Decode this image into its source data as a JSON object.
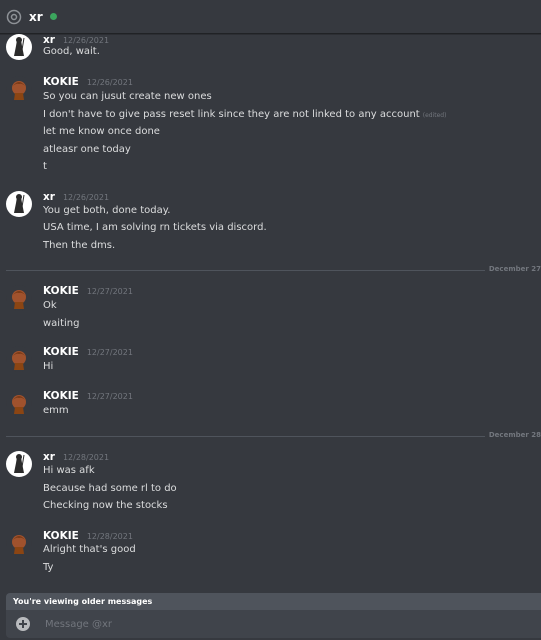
{
  "header": {
    "at_symbol": "@",
    "title": "xr",
    "status_color": "#3ba55d"
  },
  "messages": [
    {
      "author": "xr",
      "timestamp": "12/26/2021",
      "lines": [
        "Good, wait."
      ]
    },
    {
      "author": "KOKIE",
      "timestamp": "12/26/2021",
      "lines": [
        "So you can jusut create new ones",
        "I don't have to give pass reset link since they are not linked to any account",
        "let me know once done",
        "atleasr one today",
        "t"
      ],
      "edited_label": "(edited)"
    },
    {
      "author": "xr",
      "timestamp": "12/26/2021",
      "lines": [
        "You get both, done today.",
        "USA time, I am solving rn tickets via discord.",
        "Then the dms."
      ]
    },
    {
      "author": "KOKIE",
      "timestamp": "12/27/2021",
      "lines": [
        "Ok",
        "waiting"
      ]
    },
    {
      "author": "KOKIE",
      "timestamp": "12/27/2021",
      "lines": [
        "Hi"
      ]
    },
    {
      "author": "KOKIE",
      "timestamp": "12/27/2021",
      "lines": [
        "emm"
      ]
    },
    {
      "author": "xr",
      "timestamp": "12/28/2021",
      "lines": [
        "Hi was afk",
        "Because had some rl to do",
        "Checking now the stocks"
      ]
    },
    {
      "author": "KOKIE",
      "timestamp": "12/28/2021",
      "lines": [
        "Alright that's good",
        "Ty"
      ]
    }
  ],
  "dividers": [
    "December 27",
    "December 28"
  ],
  "older_banner": "You're viewing older messages",
  "composer": {
    "placeholder": "Message @xr"
  },
  "colors": {
    "background": "#36393f",
    "composer": "#40444b",
    "banner": "#4f545c",
    "online": "#3ba55d"
  }
}
